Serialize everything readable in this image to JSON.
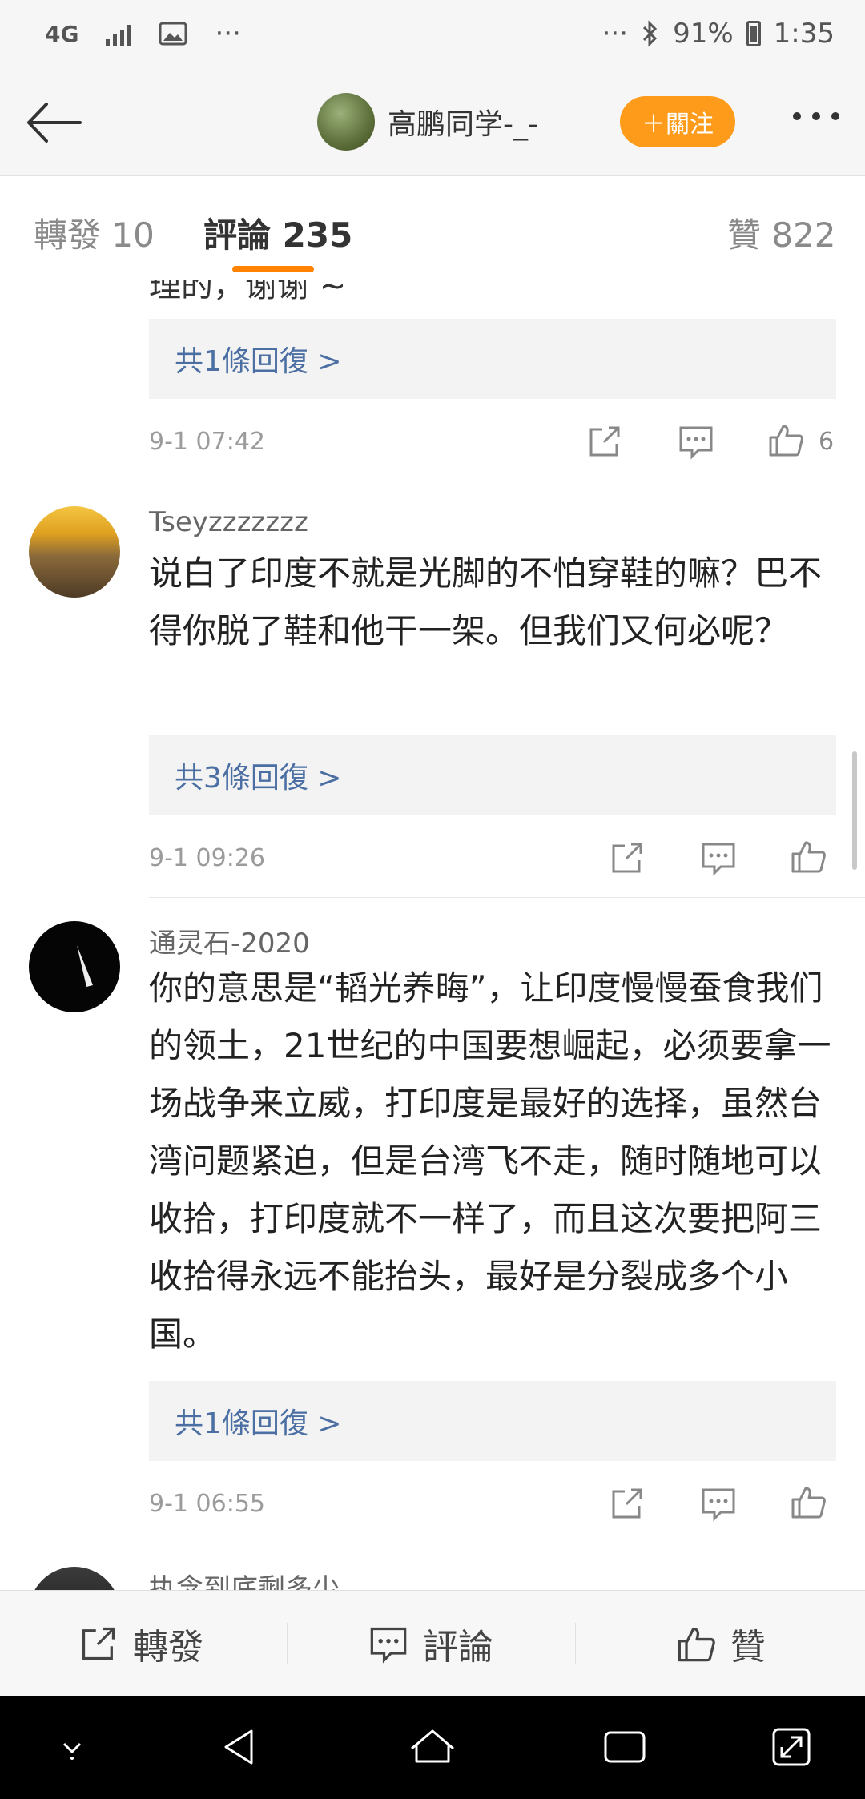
{
  "status_bar": {
    "network": "4G",
    "dots_left": "···",
    "dots_right": "···",
    "battery": "91%",
    "time": "1:35"
  },
  "header": {
    "user_name": "高鹏同学-_-",
    "follow_label": "＋關注"
  },
  "tabs": {
    "repost": "轉發 10",
    "comments": "評論 235",
    "likes": "贊 822"
  },
  "comments": [
    {
      "cut_text": "理的，谢谢 ~",
      "reply_link": "共1條回復 >",
      "time": "9-1 07:42",
      "likes": "6"
    },
    {
      "user": "Tseyzzzzzzz",
      "text": "说白了印度不就是光脚的不怕穿鞋的嘛？巴不得你脱了鞋和他干一架。但我们又何必呢？",
      "reply_link": "共3條回復 >",
      "time": "9-1 09:26",
      "likes": ""
    },
    {
      "user": "通灵石-2020",
      "text": "你的意思是“韬光养晦”，让印度慢慢蚕食我们的领土，21世纪的中国要想崛起，必须要拿一场战争来立威，打印度是最好的选择，虽然台湾问题紧迫，但是台湾飞不走，随时随地可以收拾，打印度就不一样了，而且这次要把阿三收拾得永远不能抬头，最好是分裂成多个小国。",
      "reply_link": "共1條回復 >",
      "time": "9-1 06:55",
      "likes": ""
    },
    {
      "user": "执念到底剩多少"
    }
  ],
  "bottom_bar": {
    "repost": "轉發",
    "comment": "評論",
    "like": "贊"
  },
  "colors": {
    "accent": "#ff8200",
    "follow_button": "#ff9b1a",
    "link": "#4b6fa3"
  }
}
